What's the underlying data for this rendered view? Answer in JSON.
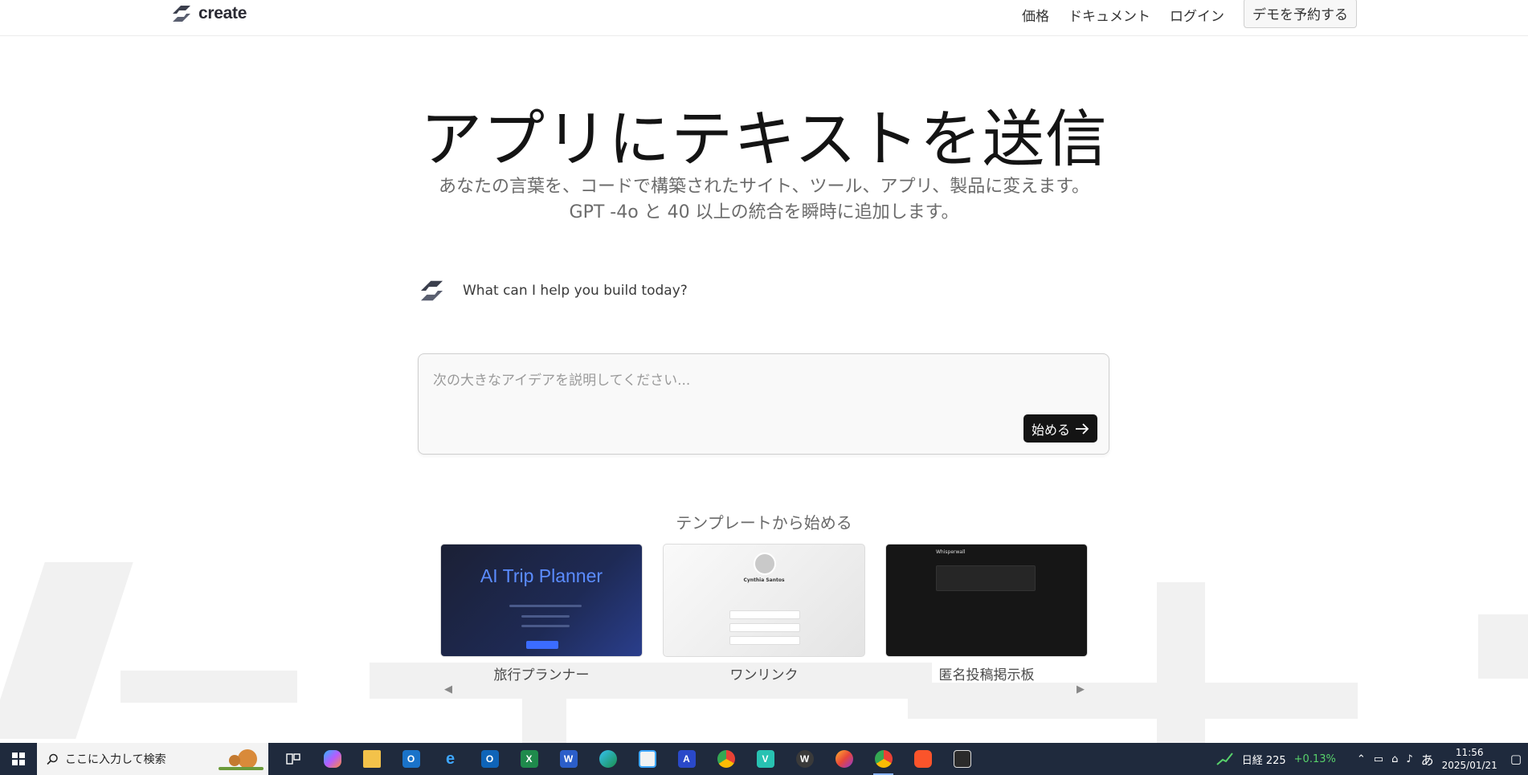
{
  "header": {
    "logo_text": "create",
    "nav": [
      "価格",
      "ドキュメント",
      "ログイン"
    ],
    "demo_button": "デモを予約する"
  },
  "hero": {
    "title": "アプリにテキストを送信",
    "subtitle": "あなたの言葉を、コードで構築されたサイト、ツール、アプリ、製品に変えます。GPT -4o と 40 以上の統合を瞬時に追加します。"
  },
  "assistant": {
    "prompt": "What can I help you build today?"
  },
  "composer": {
    "placeholder": "次の大きなアイデアを説明してください...",
    "value": "",
    "start_button": "始める"
  },
  "templates": {
    "heading": "テンプレートから始める",
    "items": [
      {
        "label": "旅行プランナー",
        "thumb_title": "AI Trip Planner",
        "thumb_author": "",
        "thumb_brand": ""
      },
      {
        "label": "ワンリンク",
        "thumb_title": "",
        "thumb_author": "Cynthia Santos",
        "thumb_brand": ""
      },
      {
        "label": "匿名投稿掲示板",
        "thumb_title": "",
        "thumb_author": "",
        "thumb_brand": "Whisperwall"
      }
    ]
  },
  "taskbar": {
    "search_placeholder": "ここに入力して検索",
    "nikkei_label": "日経 225",
    "nikkei_change": "+0.13%",
    "ime": "あ",
    "time": "11:56",
    "date": "2025/01/21"
  }
}
